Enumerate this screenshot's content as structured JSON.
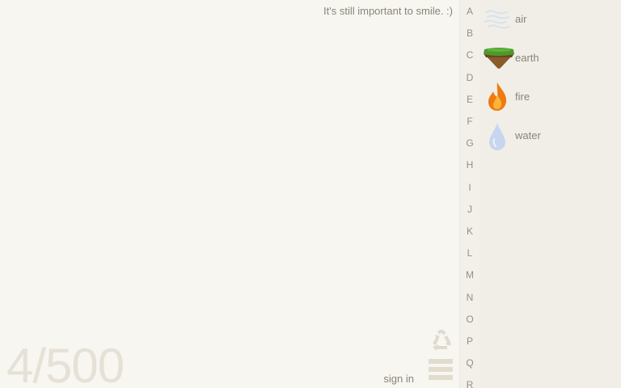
{
  "header": {
    "tagline": "It's still important to smile. :)"
  },
  "footer": {
    "counter": "4/500",
    "sign_in": "sign in"
  },
  "icons": {
    "recycle": "recycle-icon",
    "menu": "hamburger-menu-icon"
  },
  "alphabet": [
    "A",
    "B",
    "C",
    "D",
    "E",
    "F",
    "G",
    "H",
    "I",
    "J",
    "K",
    "L",
    "M",
    "N",
    "O",
    "P",
    "Q",
    "R"
  ],
  "elements": [
    {
      "label": "air",
      "icon": "air-icon"
    },
    {
      "label": "earth",
      "icon": "earth-icon"
    },
    {
      "label": "fire",
      "icon": "fire-icon"
    },
    {
      "label": "water",
      "icon": "water-icon"
    }
  ],
  "colors": {
    "background": "#f7f5f0",
    "text": "#8a8478",
    "counter": "#e6e1d6",
    "earth_grass": "#4c9a2a",
    "fire": "#f07a10",
    "water": "#c7d6ee"
  }
}
